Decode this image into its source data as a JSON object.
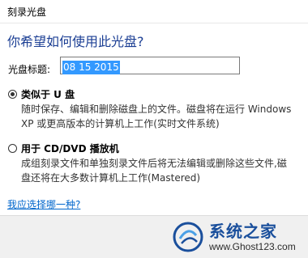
{
  "window": {
    "title": "刻录光盘"
  },
  "heading": "你希望如何使用此光盘?",
  "disc_title": {
    "label": "光盘标题:",
    "value": "08 15 2015"
  },
  "options": [
    {
      "label": "类似于 U 盘",
      "checked": true,
      "desc_line1": "随时保存、编辑和删除磁盘上的文件。磁盘将在运行 Windows",
      "desc_line2": "XP 或更高版本的计算机上工作(实时文件系统)"
    },
    {
      "label": "用于 CD/DVD 播放机",
      "checked": false,
      "desc_line1": "成组刻录文件和单独刻录文件后将无法编辑或删除这些文件,磁",
      "desc_line2": "盘还将在大多数计算机上工作(Mastered)"
    }
  ],
  "help_link": "我应选择哪一种?",
  "watermark": {
    "name": "系统之家",
    "url": "www.Ghost123.com"
  }
}
